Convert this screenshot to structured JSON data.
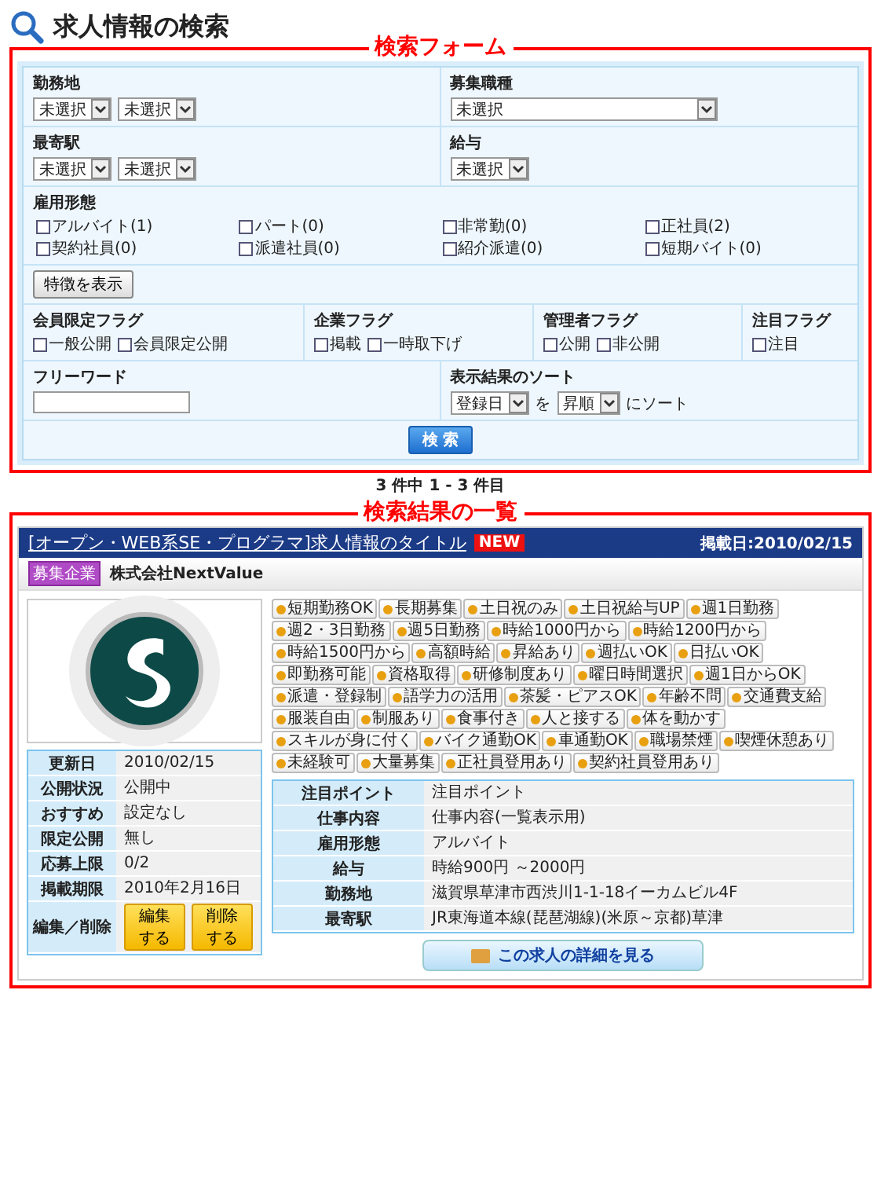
{
  "page_title": "求人情報の検索",
  "search_form": {
    "annotation": "検索フォーム",
    "rows": [
      {
        "cells": [
          {
            "label": "勤務地",
            "kind": "inline",
            "controls": [
              {
                "kind": "select",
                "value": "未選択"
              },
              {
                "kind": "select",
                "value": "未選択"
              }
            ]
          },
          {
            "label": "募集職種",
            "kind": "inline",
            "controls": [
              {
                "kind": "select",
                "value": "未選択"
              }
            ]
          }
        ]
      },
      {
        "cells": [
          {
            "label": "最寄駅",
            "kind": "inline",
            "controls": [
              {
                "kind": "select",
                "value": "未選択"
              },
              {
                "kind": "select",
                "value": "未選択"
              }
            ]
          },
          {
            "label": "給与",
            "kind": "inline",
            "controls": [
              {
                "kind": "select",
                "value": "未選択"
              }
            ]
          }
        ]
      },
      {
        "cells": [
          {
            "label": "雇用形態",
            "kind": "grid",
            "controls": [
              {
                "kind": "checkbox",
                "label": "アルバイト(1)",
                "checked": false
              },
              {
                "kind": "checkbox",
                "label": "パート(0)",
                "checked": false
              },
              {
                "kind": "checkbox",
                "label": "非常勤(0)",
                "checked": false
              },
              {
                "kind": "checkbox",
                "label": "正社員(2)",
                "checked": false
              },
              {
                "kind": "checkbox",
                "label": "契約社員(0)",
                "checked": false
              },
              {
                "kind": "checkbox",
                "label": "派遣社員(0)",
                "checked": false
              },
              {
                "kind": "checkbox",
                "label": "紹介派遣(0)",
                "checked": false
              },
              {
                "kind": "checkbox",
                "label": "短期バイト(0)",
                "checked": false
              }
            ]
          }
        ]
      },
      {
        "cells": [
          {
            "kind": "inline",
            "controls": [
              {
                "kind": "button",
                "text": "特徴を表示"
              }
            ]
          }
        ]
      },
      {
        "cells": [
          {
            "label": "会員限定フラグ",
            "kind": "inline",
            "controls": [
              {
                "kind": "checkbox",
                "label": "一般公開",
                "checked": false
              },
              {
                "kind": "checkbox",
                "label": "会員限定公開",
                "checked": false
              }
            ]
          },
          {
            "label": "企業フラグ",
            "kind": "inline",
            "controls": [
              {
                "kind": "checkbox",
                "label": "掲載",
                "checked": false
              },
              {
                "kind": "checkbox",
                "label": "一時取下げ",
                "checked": false
              }
            ]
          },
          {
            "label": "管理者フラグ",
            "kind": "inline",
            "controls": [
              {
                "kind": "checkbox",
                "label": "公開",
                "checked": false
              },
              {
                "kind": "checkbox",
                "label": "非公開",
                "checked": false
              }
            ]
          },
          {
            "label": "注目フラグ",
            "kind": "inline",
            "controls": [
              {
                "kind": "checkbox",
                "label": "注目",
                "checked": false
              }
            ]
          }
        ]
      },
      {
        "cells": [
          {
            "label": "フリーワード",
            "kind": "inline",
            "controls": [
              {
                "kind": "input"
              }
            ]
          },
          {
            "label": "表示結果のソート",
            "kind": "inline",
            "controls": [
              {
                "kind": "select",
                "value": "登録日"
              },
              {
                "kind": "text",
                "text": "を"
              },
              {
                "kind": "select",
                "value": "昇順"
              },
              {
                "kind": "text",
                "text": "にソート"
              }
            ]
          }
        ]
      },
      {
        "cells": [
          {
            "kind": "center",
            "controls": [
              {
                "kind": "submit",
                "text": "検 索"
              }
            ]
          }
        ]
      }
    ]
  },
  "pager": "3 件中 1 - 3 件目",
  "results": {
    "annotation": "検索結果の一覧",
    "listings": [
      {
        "title": "[オープン・WEB系SE・プログラマ]求人情報のタイトル",
        "badge": "NEW",
        "posted": "掲載日:2010/02/15",
        "category": "募集企業",
        "company": "株式会社NextValue",
        "features": [
          "短期勤務OK",
          "長期募集",
          "土日祝のみ",
          "土日祝給与UP",
          "週1日勤務",
          "週2・3日勤務",
          "週5日勤務",
          "時給1000円から",
          "時給1200円から",
          "時給1500円から",
          "高額時給",
          "昇給あり",
          "週払いOK",
          "日払いOK",
          "即勤務可能",
          "資格取得",
          "研修制度あり",
          "曜日時間選択",
          "週1日からOK",
          "派遣・登録制",
          "語学力の活用",
          "茶髪・ピアスOK",
          "年齢不問",
          "交通費支給",
          "服装自由",
          "制服あり",
          "食事付き",
          "人と接する",
          "体を動かす",
          "スキルが身に付く",
          "バイク通勤OK",
          "車通勤OK",
          "職場禁煙",
          "喫煙休憩あり",
          "未経験可",
          "大量募集",
          "正社員登用あり",
          "契約社員登用あり"
        ],
        "info": [
          {
            "label": "更新日",
            "value": "2010/02/15"
          },
          {
            "label": "公開状況",
            "value": "公開中"
          },
          {
            "label": "おすすめ",
            "value": "設定なし"
          },
          {
            "label": "限定公開",
            "value": "無し"
          },
          {
            "label": "応募上限",
            "value": "0/2"
          },
          {
            "label": "掲載期限",
            "value": "2010年2月16日"
          }
        ],
        "edit_label": "編集／削除",
        "edit_buttons": [
          "編集する",
          "削除する"
        ],
        "details": [
          {
            "label": "注目ポイント",
            "value": "注目ポイント"
          },
          {
            "label": "仕事内容",
            "value": "仕事内容(一覧表示用)"
          },
          {
            "label": "雇用形態",
            "value": "アルバイト"
          },
          {
            "label": "給与",
            "value": "時給900円 ～2000円"
          },
          {
            "label": "勤務地",
            "value": "滋賀県草津市西渋川1-1-18イーカムビル4F"
          },
          {
            "label": "最寄駅",
            "value": "JR東海道本線(琵琶湖線)(米原～京都)草津"
          }
        ],
        "detail_button": "この求人の詳細を見る"
      }
    ]
  }
}
